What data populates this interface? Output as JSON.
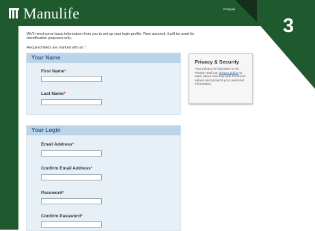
{
  "header": {
    "brand": "Manulife",
    "language_link": "Français"
  },
  "intro_text": "We'll need some basic information from you to set up your login profile. Rest assured, it will be used for identification purposes only.",
  "required_note": "Required fields are marked with an",
  "required_marker": "*",
  "your_name": {
    "title": "Your Name",
    "first_name_label": "First Name",
    "last_name_label": "Last Name"
  },
  "your_login": {
    "title": "Your Login",
    "email_label": "Email Address",
    "confirm_email_label": "Confirm Email Address",
    "password_label": "Password",
    "confirm_password_label": "Confirm Password"
  },
  "privacy": {
    "title": "Privacy & Security",
    "text_before_link": "Your privacy is important to us. Please read our ",
    "link": "privacy policy",
    "text_after_link": " to learn about how Manulife Financial values and protects your personal information."
  },
  "step_badge": "3",
  "colors": {
    "brand_green": "#1f5a2e",
    "dark_corner": "#14301c",
    "section_header_bg": "#bcd4e8",
    "section_title": "#2e5f93",
    "section_bg": "#e7f0f7"
  }
}
